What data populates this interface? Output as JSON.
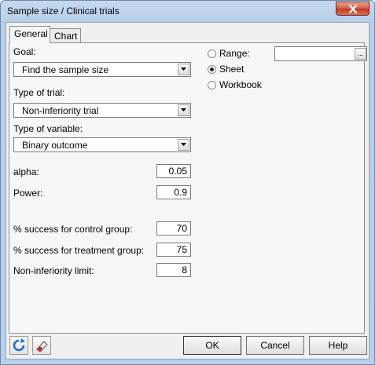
{
  "window": {
    "title": "Sample size / Clinical trials"
  },
  "tabs": [
    {
      "label": "General"
    },
    {
      "label": "Chart"
    }
  ],
  "goal": {
    "label": "Goal:",
    "value": "Find the sample size"
  },
  "trial_type": {
    "label": "Type of trial:",
    "value": "Non-inferiority trial"
  },
  "variable_type": {
    "label": "Type of variable:",
    "value": "Binary outcome"
  },
  "params": {
    "alpha": {
      "label": "alpha:",
      "value": "0.05"
    },
    "power": {
      "label": "Power:",
      "value": "0.9"
    },
    "control": {
      "label": "% success for control group:",
      "value": "70"
    },
    "treatment": {
      "label": "% success for treatment group:",
      "value": "75"
    },
    "limit": {
      "label": "Non-inferiority limit:",
      "value": "8"
    }
  },
  "output": {
    "range": {
      "label": "Range:",
      "checked": false,
      "value": "",
      "button": "..."
    },
    "sheet": {
      "label": "Sheet",
      "checked": true
    },
    "workbook": {
      "label": "Workbook",
      "checked": false
    }
  },
  "buttons": {
    "ok": "OK",
    "cancel": "Cancel",
    "help": "Help"
  },
  "icons": {
    "reset": "reset-icon",
    "eraser": "eraser-icon",
    "close": "close-icon"
  },
  "colors": {
    "close_button": "#c23a1f",
    "reset_icon": "#1f6fd1",
    "eraser_tip": "#d8203a"
  }
}
